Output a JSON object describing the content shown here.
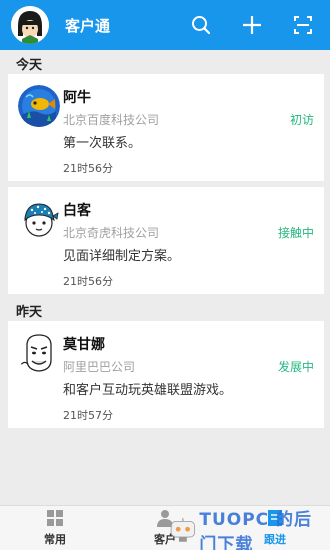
{
  "app": {
    "title": "客户通"
  },
  "colors": {
    "brand": "#1896ec",
    "status_green": "#25b87f",
    "watermark": "#2c6cd6"
  },
  "top_icons": [
    "search-icon",
    "plus-icon",
    "scan-icon"
  ],
  "sections": [
    {
      "header": "今天",
      "cards": [
        {
          "name": "阿牛",
          "company": "北京百度科技公司",
          "status": "初访",
          "note": "第一次联系。",
          "time": "21时56分",
          "avatar_icon": "fish-avatar-icon"
        },
        {
          "name": "白客",
          "company": "北京奇虎科技公司",
          "status": "接触中",
          "note": "见面详细制定方案。",
          "time": "21时56分",
          "avatar_icon": "bandana-avatar-icon"
        }
      ]
    },
    {
      "header": "昨天",
      "cards": [
        {
          "name": "莫甘娜",
          "company": "阿里巴巴公司",
          "status": "发展中",
          "note": "和客户互动玩英雄联盟游戏。",
          "time": "21时57分",
          "avatar_icon": "meme-face-avatar-icon"
        }
      ]
    }
  ],
  "bottom_nav": [
    {
      "label": "常用",
      "icon": "grid-icon",
      "active": false
    },
    {
      "label": "客户",
      "icon": "person-icon",
      "active": false
    },
    {
      "label": "跟进",
      "icon": "document-icon",
      "active": true
    }
  ],
  "watermark": {
    "text": "TUOPC 的后门下载"
  }
}
